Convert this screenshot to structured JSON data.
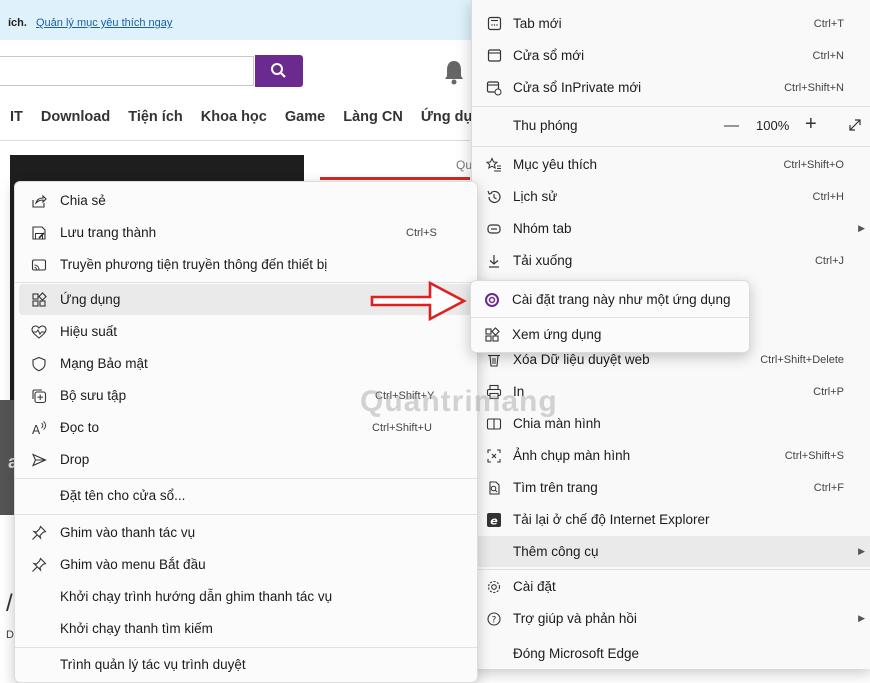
{
  "background_page": {
    "topbar_bold": "ích.",
    "topbar_link": "Quản lý mục yêu thích ngay",
    "nav": [
      "IT",
      "Download",
      "Tiện ích",
      "Khoa học",
      "Game",
      "Làng CN",
      "Ứng dụng"
    ],
    "side_text": "Qu",
    "banner_char": "a",
    "bottom_char": "/",
    "bottom_small": "DI"
  },
  "main_menu": {
    "items": [
      {
        "icon": "new-tab-icon",
        "label": "Tab mới",
        "shortcut": "Ctrl+T"
      },
      {
        "icon": "new-window-icon",
        "label": "Cửa sổ mới",
        "shortcut": "Ctrl+N"
      },
      {
        "icon": "inprivate-window-icon",
        "label": "Cửa sổ InPrivate mới",
        "shortcut": "Ctrl+Shift+N"
      },
      {
        "icon": "favorites-icon",
        "label": "Mục yêu thích",
        "shortcut": "Ctrl+Shift+O"
      },
      {
        "icon": "history-icon",
        "label": "Lịch sử",
        "shortcut": "Ctrl+H"
      },
      {
        "icon": "tab-groups-icon",
        "label": "Nhóm tab",
        "shortcut": ""
      },
      {
        "icon": "download-icon",
        "label": "Tải xuống",
        "shortcut": "Ctrl+J"
      },
      {
        "icon": "clear-data-icon",
        "label": "Xóa Dữ liệu duyệt web",
        "shortcut": "Ctrl+Shift+Delete"
      },
      {
        "icon": "print-icon",
        "label": "In",
        "shortcut": "Ctrl+P"
      },
      {
        "icon": "split-screen-icon",
        "label": "Chia màn hình",
        "shortcut": ""
      },
      {
        "icon": "screenshot-icon",
        "label": "Ảnh chụp màn hình",
        "shortcut": "Ctrl+Shift+S"
      },
      {
        "icon": "find-icon",
        "label": "Tìm trên trang",
        "shortcut": "Ctrl+F"
      },
      {
        "icon": "ie-mode-icon",
        "label": "Tải lại ở chế độ Internet Explorer",
        "shortcut": ""
      },
      {
        "icon": "",
        "label": "Thêm công cụ",
        "shortcut": ""
      },
      {
        "icon": "settings-icon",
        "label": "Cài đặt",
        "shortcut": ""
      },
      {
        "icon": "help-icon",
        "label": "Trợ giúp và phản hồi",
        "shortcut": ""
      },
      {
        "icon": "",
        "label": "Đóng Microsoft Edge",
        "shortcut": ""
      }
    ],
    "zoom": {
      "label": "Thu phóng",
      "minus": "—",
      "value": "100%",
      "plus": "+"
    }
  },
  "sub_menu": {
    "items": [
      {
        "icon": "share-icon",
        "label": "Chia sẻ",
        "shortcut": ""
      },
      {
        "icon": "save-page-icon",
        "label": "Lưu trang thành",
        "shortcut": "Ctrl+S"
      },
      {
        "icon": "cast-icon",
        "label": "Truyền phương tiện truyền thông đến thiết bị",
        "shortcut": ""
      },
      {
        "icon": "apps-icon",
        "label": "Ứng dụng",
        "shortcut": ""
      },
      {
        "icon": "performance-icon",
        "label": "Hiệu suất",
        "shortcut": ""
      },
      {
        "icon": "security-shield-icon",
        "label": "Mạng Bảo mật",
        "shortcut": ""
      },
      {
        "icon": "collections-icon",
        "label": "Bộ sưu tập",
        "shortcut": "Ctrl+Shift+Y"
      },
      {
        "icon": "read-aloud-icon",
        "label": "Đọc to",
        "shortcut": "Ctrl+Shift+U"
      },
      {
        "icon": "drop-icon",
        "label": "Drop",
        "shortcut": ""
      },
      {
        "icon": "",
        "label": "Đặt tên cho cửa sổ...",
        "shortcut": ""
      },
      {
        "icon": "pin-icon",
        "label": "Ghim vào thanh tác vụ",
        "shortcut": ""
      },
      {
        "icon": "pin-icon",
        "label": "Ghim vào menu Bắt đầu",
        "shortcut": ""
      },
      {
        "icon": "",
        "label": "Khởi chạy trình hướng dẫn ghim thanh tác vụ",
        "shortcut": ""
      },
      {
        "icon": "",
        "label": "Khởi chạy thanh tìm kiếm",
        "shortcut": ""
      },
      {
        "icon": "",
        "label": "Trình quản lý tác vụ trình duyệt",
        "shortcut": ""
      }
    ]
  },
  "apps_menu": {
    "items": [
      {
        "icon": "install-app-icon",
        "label": "Cài đặt trang này như một ứng dụng"
      },
      {
        "icon": "view-apps-icon",
        "label": "Xem ứng dụng"
      }
    ]
  },
  "watermark": "Quantrimang",
  "colors": {
    "accent_purple": "#6b2a8f",
    "arrow_red": "#e02020",
    "highlight": "#eaeaea"
  }
}
